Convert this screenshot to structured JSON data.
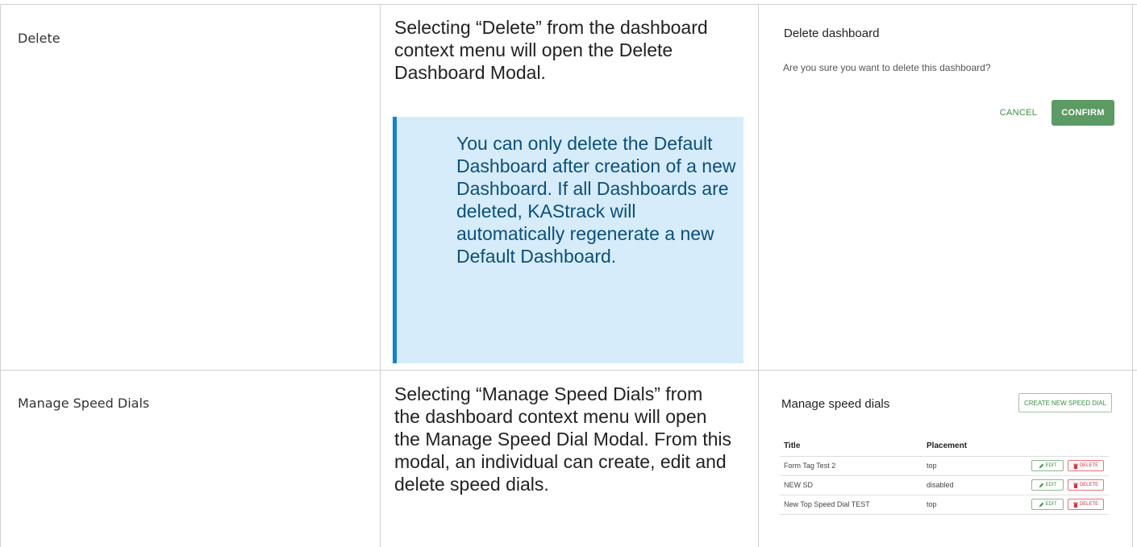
{
  "rows": [
    {
      "label": "Delete",
      "description": "Selecting “Delete” from the dashboard context menu will open the Delete Dashboard Modal.",
      "note": "You can only delete the Default Dashboard after creation of a new Dashboard. If all Dashboards are deleted, KAStrack will automatically regenerate a new Default Dashboard.",
      "modal": {
        "title": "Delete dashboard",
        "message": "Are you sure you want to delete this dashboard?",
        "cancel_label": "CANCEL",
        "confirm_label": "CONFIRM"
      }
    },
    {
      "label": "Manage Speed Dials",
      "description": "Selecting “Manage Speed Dials” from the dashboard context menu will open the Manage Speed Dial Modal. From this modal, an individual can create, edit and delete speed dials.",
      "modal": {
        "title": "Manage speed dials",
        "create_label": "CREATE NEW SPEED DIAL",
        "columns": [
          "Title",
          "Placement"
        ],
        "items": [
          {
            "title": "Form Tag Test 2",
            "placement": "top"
          },
          {
            "title": "NEW SD",
            "placement": "disabled"
          },
          {
            "title": "New Top Speed Dial TEST",
            "placement": "top"
          }
        ],
        "edit_label": "EDIT",
        "delete_label": "DELETE"
      }
    }
  ],
  "colors": {
    "note_background": "#d6ecfb",
    "note_border": "#1380d4",
    "note_text": "#0b4f7e",
    "confirm_button": "#5c9b63",
    "delete_action": "#d2343f"
  },
  "icons": [
    "pencil-icon",
    "trash-icon"
  ]
}
